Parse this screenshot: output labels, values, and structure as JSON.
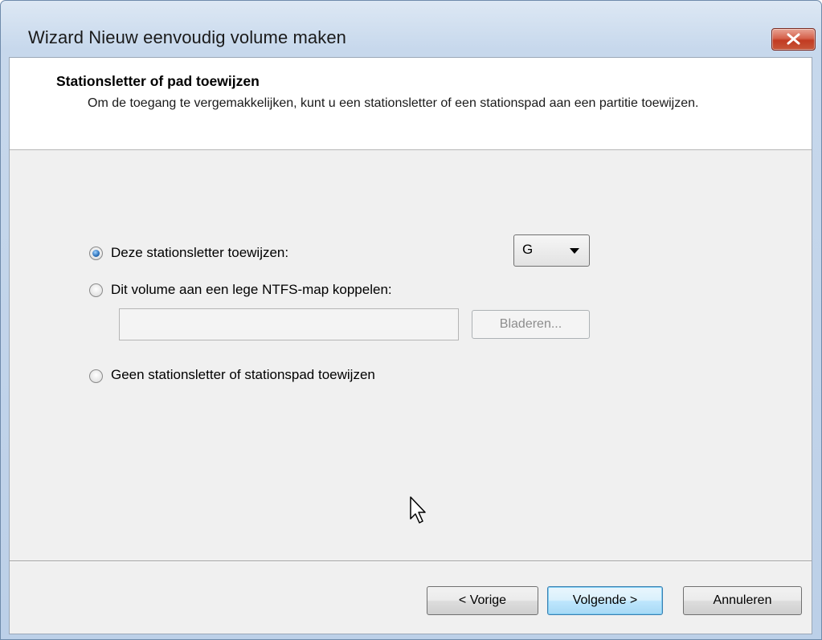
{
  "window": {
    "title": "Wizard Nieuw eenvoudig volume maken",
    "close_icon": "close-icon"
  },
  "header": {
    "title": "Stationsletter of pad toewijzen",
    "description": "Om de toegang te vergemakkelijken, kunt u een stationsletter of een stationspad aan een partitie toewijzen."
  },
  "options": {
    "assign_letter": {
      "label": "Deze stationsletter toewijzen:",
      "selected": true
    },
    "mount_folder": {
      "label": "Dit volume aan een lege NTFS-map koppelen:",
      "selected": false
    },
    "no_letter": {
      "label": "Geen stationsletter of stationspad toewijzen",
      "selected": false
    }
  },
  "drive_letter_select": {
    "value": "G"
  },
  "folder_path": {
    "value": ""
  },
  "browse_button": {
    "label": "Bladeren...",
    "enabled": false
  },
  "footer": {
    "back_label": "< Vorige",
    "next_label": "Volgende >",
    "cancel_label": "Annuleren"
  },
  "colors": {
    "accent": "#3c7fb1",
    "close_button": "#c75639"
  }
}
